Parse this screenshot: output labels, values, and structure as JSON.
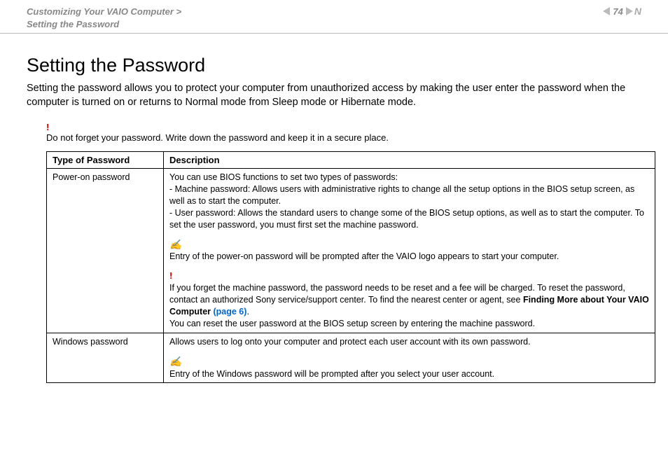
{
  "header": {
    "breadcrumb_line1": "Customizing Your VAIO Computer >",
    "breadcrumb_line2": "Setting the Password",
    "page_number": "74",
    "n_decor": "N"
  },
  "title": "Setting the Password",
  "intro": "Setting the password allows you to protect your computer from unauthorized access by making the user enter the password when the computer is turned on or returns to Normal mode from Sleep mode or Hibernate mode.",
  "warn_top": {
    "mark": "!",
    "text": "Do not forget your password. Write down the password and keep it in a secure place."
  },
  "table": {
    "headers": {
      "type": "Type of Password",
      "desc": "Description"
    },
    "rows": [
      {
        "type": "Power-on password",
        "intro": "You can use BIOS functions to set two types of passwords:",
        "bullets": [
          "- Machine password: Allows users with administrative rights to change all the setup options in the BIOS setup screen, as well as to start the computer.",
          "- User password: Allows the standard users to change some of the BIOS setup options, as well as to start the computer. To set the user password, you must first set the machine password."
        ],
        "note_icon": "✍",
        "note_text": "Entry of the power-on password will be prompted after the VAIO logo appears to start your computer.",
        "warn_mark": "!",
        "warn_text_pre": "If you forget the machine password, the password needs to be reset and a fee will be charged. To reset the password, contact an authorized Sony service/support center. To find the nearest center or agent, see ",
        "warn_link_bold": "Finding More about Your VAIO Computer ",
        "warn_link_page": "(page 6)",
        "warn_link_period": ".",
        "warn_text_post": "You can reset the user password at the BIOS setup screen by entering the machine password."
      },
      {
        "type": "Windows password",
        "intro": "Allows users to log onto your computer and protect each user account with its own password.",
        "note_icon": "✍",
        "note_text": "Entry of the Windows password will be prompted after you select your user account."
      }
    ]
  }
}
